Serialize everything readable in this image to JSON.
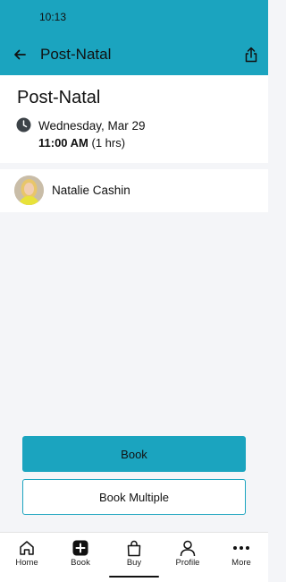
{
  "status_bar": {
    "time": "10:13"
  },
  "app_bar": {
    "title": "Post-Natal",
    "back_icon": "arrow-left-icon",
    "share_icon": "share-icon"
  },
  "class": {
    "title": "Post-Natal",
    "date": "Wednesday, Mar 29",
    "time": "11:00 AM",
    "duration": "(1 hrs)",
    "clock_icon": "clock-icon"
  },
  "instructor": {
    "name": "Natalie Cashin"
  },
  "actions": {
    "book_label": "Book",
    "book_multiple_label": "Book Multiple"
  },
  "colors": {
    "accent": "#1ba4bf",
    "background": "#f4f5f8"
  },
  "bottom_nav": {
    "items": [
      {
        "label": "Home",
        "icon": "home-icon"
      },
      {
        "label": "Book",
        "icon": "plus-box-icon"
      },
      {
        "label": "Buy",
        "icon": "shopping-bag-icon"
      },
      {
        "label": "Profile",
        "icon": "person-icon"
      },
      {
        "label": "More",
        "icon": "more-dots-icon"
      }
    ]
  }
}
